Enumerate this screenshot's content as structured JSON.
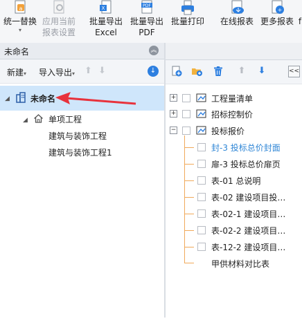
{
  "toolbar": {
    "items": [
      {
        "line1": "统一替换",
        "line2": "▾",
        "disabled": false,
        "icon": "replace-doc-icon"
      },
      {
        "line1": "应用当前",
        "line2": "报表设置",
        "disabled": true,
        "icon": "apply-settings-icon"
      },
      {
        "line1": "批量导出",
        "line2": "Excel",
        "disabled": false,
        "icon": "excel-export-icon"
      },
      {
        "line1": "批量导出",
        "line2": "PDF",
        "disabled": false,
        "icon": "pdf-export-icon"
      },
      {
        "line1": "批量打印",
        "line2": "",
        "disabled": false,
        "icon": "print-icon"
      },
      {
        "line1": "在线报表",
        "line2": "",
        "disabled": false,
        "icon": "online-report-icon"
      },
      {
        "line1": "更多报表",
        "line2": "",
        "disabled": false,
        "icon": "more-reports-icon"
      },
      {
        "line1": "f",
        "line2": "",
        "disabled": false,
        "icon": "partial-icon"
      }
    ]
  },
  "left_panel": {
    "title": "未命名",
    "new_label": "新建",
    "import_export_label": "导入导出",
    "tree": {
      "root": "未命名",
      "child": "单项工程",
      "grandchildren": [
        "建筑与装饰工程",
        "建筑与装饰工程1"
      ]
    }
  },
  "right_panel": {
    "groups": [
      {
        "label": "工程量清单",
        "expanded": false
      },
      {
        "label": "招标控制价",
        "expanded": false
      },
      {
        "label": "投标报价",
        "expanded": true
      }
    ],
    "items": [
      {
        "label": "封-3 投标总价封面",
        "highlight": true
      },
      {
        "label": "扉-3 投标总价扉页",
        "highlight": false
      },
      {
        "label": "表-01 总说明",
        "highlight": false
      },
      {
        "label": "表-02 建设项目投…",
        "highlight": false
      },
      {
        "label": "表-02-1 建设项目…",
        "highlight": false
      },
      {
        "label": "表-02-2 建设项目…",
        "highlight": false
      },
      {
        "label": "表-12-2 建设项目…",
        "highlight": false
      },
      {
        "label": "甲供材料对比表",
        "highlight": false
      }
    ]
  },
  "colors": {
    "accent_blue": "#2d7fe0",
    "selection": "#cfe6fb",
    "highlight_text": "#2f86d6",
    "annotation_red": "#e8323c"
  }
}
